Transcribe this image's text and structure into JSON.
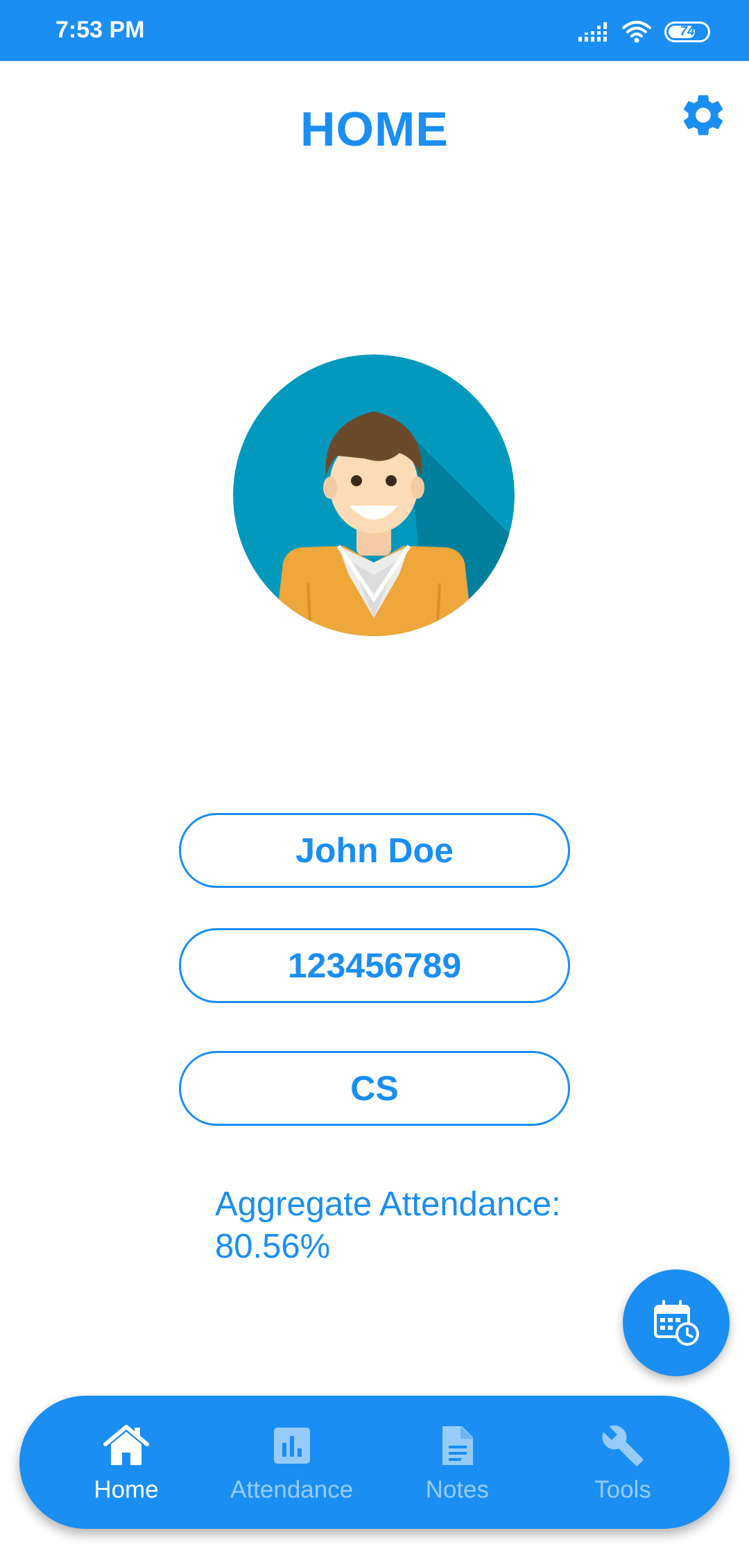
{
  "status_bar": {
    "time": "7:53 PM",
    "battery": "74",
    "battery_level": 0.74
  },
  "header": {
    "title": "HOME"
  },
  "profile": {
    "name": "John Doe",
    "id": "123456789",
    "department": "CS",
    "attendance_text": "Aggregate Attendance: 80.56%"
  },
  "bottom_nav": {
    "items": [
      {
        "label": "Home",
        "icon": "home-icon",
        "active": true
      },
      {
        "label": "Attendance",
        "icon": "bar-chart-icon",
        "active": false
      },
      {
        "label": "Notes",
        "icon": "document-icon",
        "active": false
      },
      {
        "label": "Tools",
        "icon": "wrench-icon",
        "active": false
      }
    ]
  },
  "colors": {
    "primary": "#1a8ef2",
    "background": "#ffffff",
    "avatar_bg": "#0399bd",
    "sweater": "#efa63a",
    "hair": "#6b4a2b"
  }
}
